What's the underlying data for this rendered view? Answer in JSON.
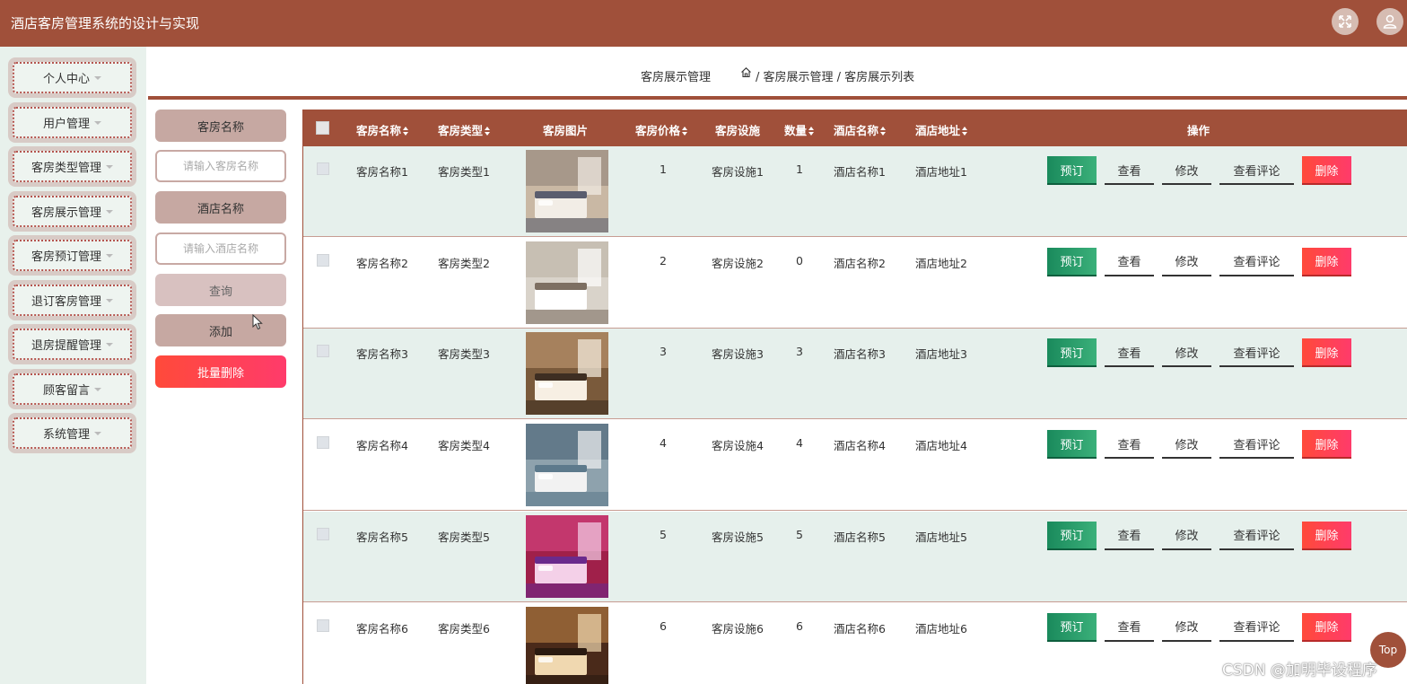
{
  "header": {
    "title": "酒店客房管理系统的设计与实现"
  },
  "sidebar": {
    "items": [
      {
        "label": "个人中心"
      },
      {
        "label": "用户管理"
      },
      {
        "label": "客房类型管理"
      },
      {
        "label": "客房展示管理"
      },
      {
        "label": "客房预订管理"
      },
      {
        "label": "退订客房管理"
      },
      {
        "label": "退房提醒管理"
      },
      {
        "label": "顾客留言"
      },
      {
        "label": "系统管理"
      }
    ]
  },
  "breadcrumb": {
    "title": "客房展示管理",
    "path": "/ 客房展示管理 / 客房展示列表"
  },
  "search": {
    "room_name_label": "客房名称",
    "room_name_placeholder": "请输入客房名称",
    "hotel_name_label": "酒店名称",
    "hotel_name_placeholder": "请输入酒店名称",
    "query_label": "查询",
    "add_label": "添加",
    "batch_delete_label": "批量删除"
  },
  "table": {
    "headers": {
      "name": "客房名称",
      "type": "客房类型",
      "image": "客房图片",
      "price": "客房价格",
      "facility": "客房设施",
      "quantity": "数量",
      "hotel": "酒店名称",
      "address": "酒店地址",
      "actions": "操作"
    },
    "actions": {
      "book": "预订",
      "view": "查看",
      "edit": "修改",
      "review": "查看评论",
      "delete": "删除"
    },
    "rows": [
      {
        "name": "客房名称1",
        "type": "客房类型1",
        "price": "1",
        "facility": "客房设施1",
        "quantity": "1",
        "hotel": "酒店名称1",
        "address": "酒店地址1"
      },
      {
        "name": "客房名称2",
        "type": "客房类型2",
        "price": "2",
        "facility": "客房设施2",
        "quantity": "0",
        "hotel": "酒店名称2",
        "address": "酒店地址2"
      },
      {
        "name": "客房名称3",
        "type": "客房类型3",
        "price": "3",
        "facility": "客房设施3",
        "quantity": "3",
        "hotel": "酒店名称3",
        "address": "酒店地址3"
      },
      {
        "name": "客房名称4",
        "type": "客房类型4",
        "price": "4",
        "facility": "客房设施4",
        "quantity": "4",
        "hotel": "酒店名称4",
        "address": "酒店地址4"
      },
      {
        "name": "客房名称5",
        "type": "客房类型5",
        "price": "5",
        "facility": "客房设施5",
        "quantity": "5",
        "hotel": "酒店名称5",
        "address": "酒店地址5"
      },
      {
        "name": "客房名称6",
        "type": "客房类型6",
        "price": "6",
        "facility": "客房设施6",
        "quantity": "6",
        "hotel": "酒店名称6",
        "address": "酒店地址6"
      }
    ]
  },
  "misc": {
    "top_label": "Top",
    "watermark": "CSDN @加明毕设程序"
  },
  "colors": {
    "brand": "#a0503a",
    "book_green": "#1a8a5c",
    "delete_red": "#ff4a3a",
    "row_tint": "#e6f0ec"
  },
  "icons": {
    "fullscreen": "fullscreen-icon",
    "user": "user-icon",
    "home": "home-icon"
  }
}
